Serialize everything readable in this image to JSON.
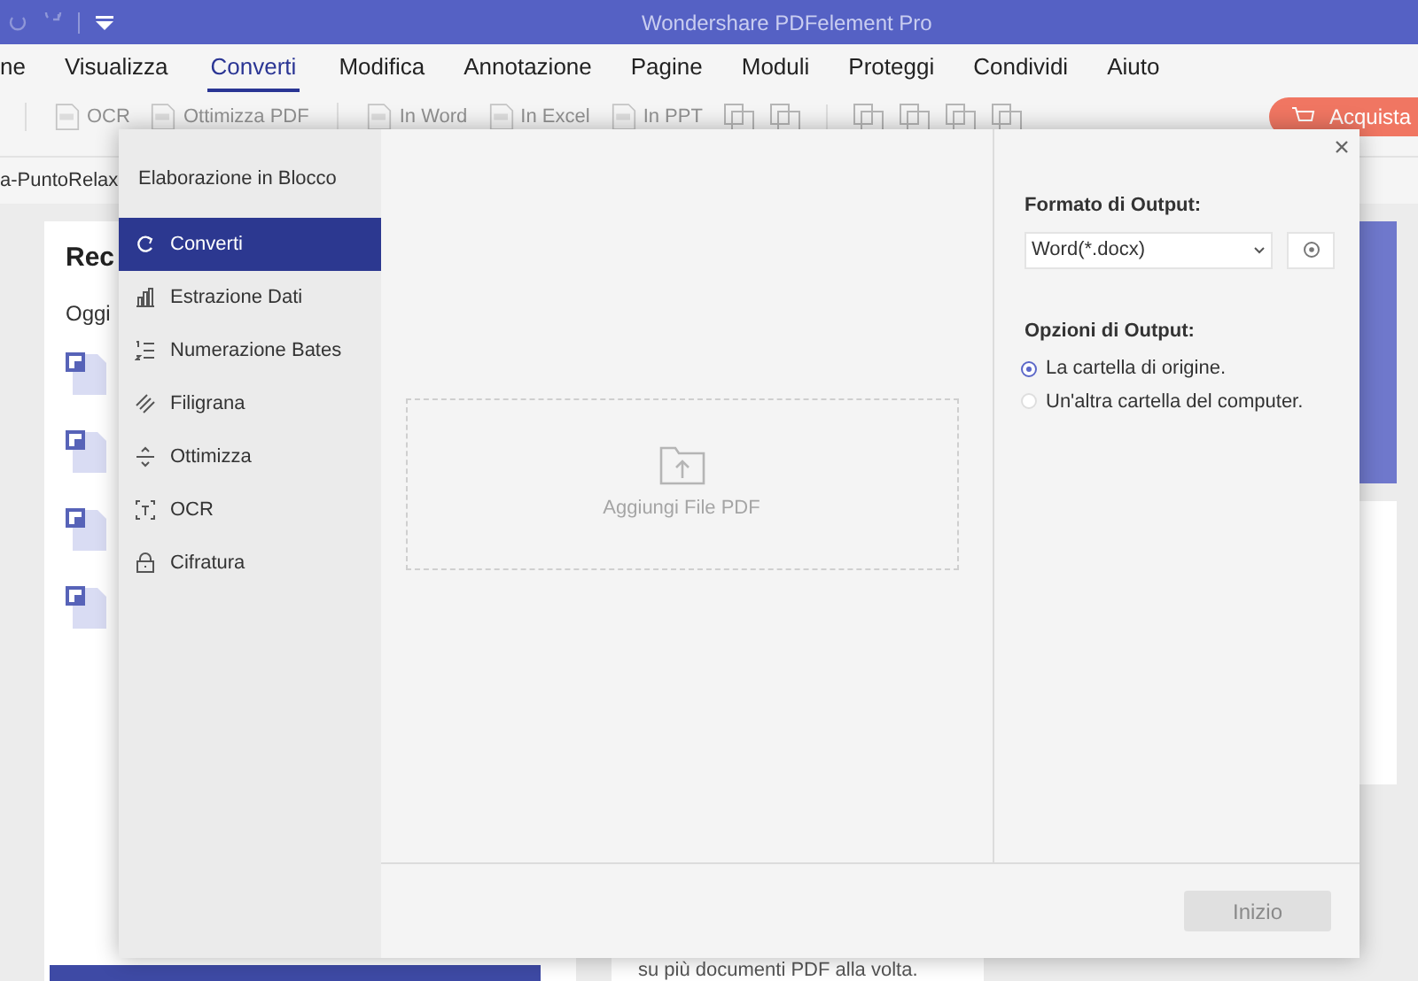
{
  "window": {
    "title": "Wondershare PDFelement Pro"
  },
  "menu": [
    {
      "label": "ne",
      "selected": false
    },
    {
      "label": "Visualizza",
      "selected": false
    },
    {
      "label": "Converti",
      "selected": true
    },
    {
      "label": "Modifica",
      "selected": false
    },
    {
      "label": "Annotazione",
      "selected": false
    },
    {
      "label": "Pagine",
      "selected": false
    },
    {
      "label": "Moduli",
      "selected": false
    },
    {
      "label": "Proteggi",
      "selected": false
    },
    {
      "label": "Condividi",
      "selected": false
    },
    {
      "label": "Aiuto",
      "selected": false
    }
  ],
  "toolbar": [
    {
      "label": "OCR"
    },
    {
      "label": "Ottimizza PDF"
    },
    {
      "label": "In Word"
    },
    {
      "label": "In Excel"
    },
    {
      "label": "In PPT"
    }
  ],
  "buy_button": "Acquista",
  "document_tab": "a-PuntoRelax",
  "background": {
    "heading": "Rec",
    "group": "Oggi",
    "snippet": "su più documenti PDF alla volta."
  },
  "dialog": {
    "title": "Elaborazione in Blocco",
    "nav": [
      {
        "label": "Converti",
        "selected": true
      },
      {
        "label": "Estrazione Dati",
        "selected": false
      },
      {
        "label": "Numerazione Bates",
        "selected": false
      },
      {
        "label": "Filigrana",
        "selected": false
      },
      {
        "label": "Ottimizza",
        "selected": false
      },
      {
        "label": "OCR",
        "selected": false
      },
      {
        "label": "Cifratura",
        "selected": false
      }
    ],
    "drop_zone": "Aggiungi File PDF",
    "output_format_label": "Formato di Output:",
    "output_format": "Word(*.docx)",
    "options_label": "Opzioni di Output:",
    "options": [
      {
        "label": "La cartella di origine.",
        "selected": true
      },
      {
        "label": "Un'altra cartella del computer.",
        "selected": false
      }
    ],
    "start_button": {
      "label": "Inizio",
      "disabled": true
    }
  }
}
